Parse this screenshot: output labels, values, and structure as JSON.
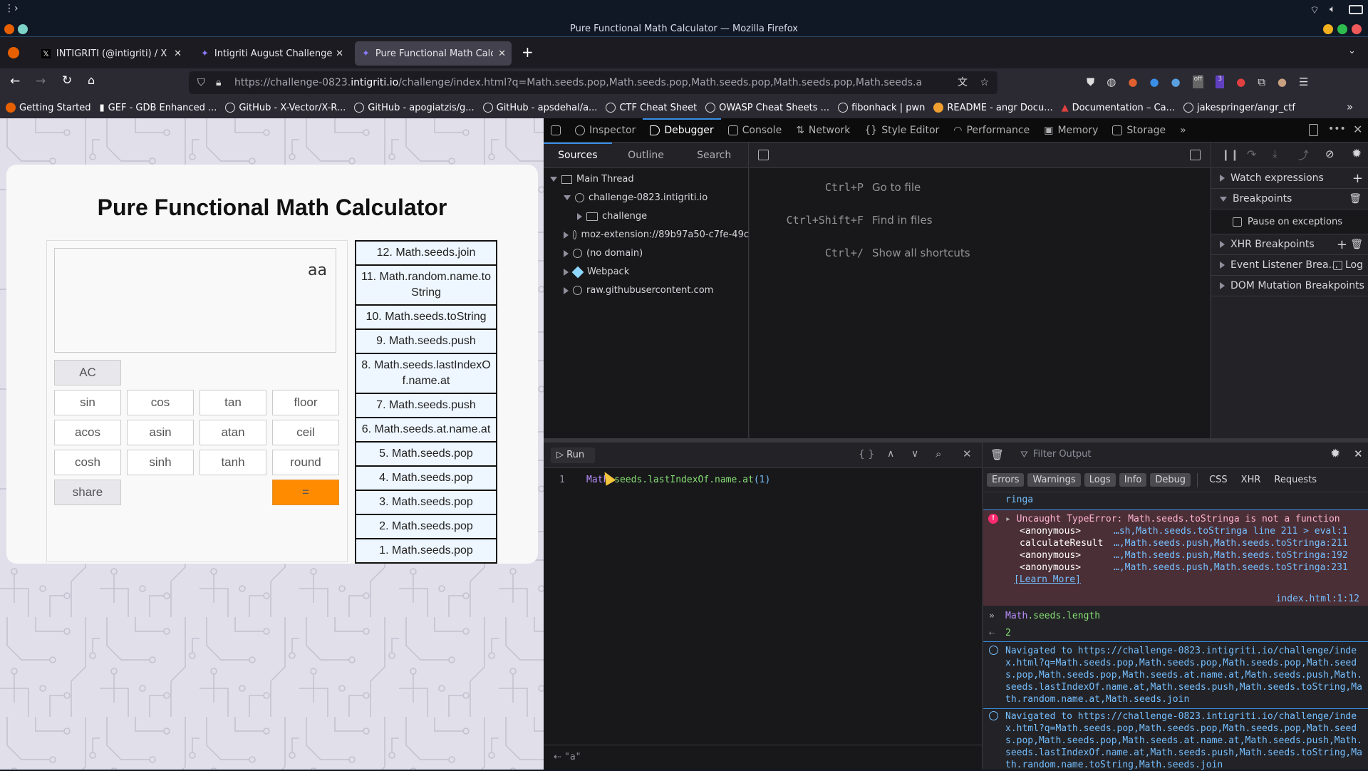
{
  "window": {
    "title": "Pure Functional Math Calculator — Mozilla Firefox"
  },
  "tabs": [
    {
      "label": "INTIGRITI (@intigriti) / X",
      "icon": "x-logo-icon"
    },
    {
      "label": "Intigriti August Challenge",
      "icon": "intigriti-icon"
    },
    {
      "label": "Pure Functional Math Calc",
      "icon": "intigriti-icon",
      "active": true
    }
  ],
  "url": {
    "prefix": "https://challenge-0823.",
    "domain": "intigriti.io",
    "path": "/challenge/index.html?q=Math.seeds.pop,Math.seeds.pop,Math.seeds.pop,Math.seeds.pop,Math.seeds.a"
  },
  "toolbar_badges": {
    "off": "off",
    "count": "3"
  },
  "bookmarks": [
    "Getting Started",
    "GEF - GDB Enhanced ...",
    "GitHub - X-Vector/X-R...",
    "GitHub - apogiatzis/g...",
    "GitHub - apsdehal/a...",
    "CTF Cheat Sheet",
    "OWASP Cheat Sheets ...",
    "fibonhack | pwn",
    "README - angr Docu...",
    "Documentation – Ca...",
    "jakespringer/angr_ctf"
  ],
  "calculator": {
    "title": "Pure Functional Math Calculator",
    "display": "aa",
    "buttons": {
      "ac": "AC",
      "row1": [
        "sin",
        "cos",
        "tan",
        "floor"
      ],
      "row2": [
        "acos",
        "asin",
        "atan",
        "ceil"
      ],
      "row3": [
        "cosh",
        "sinh",
        "tanh",
        "round"
      ],
      "share": "share",
      "equals": "="
    },
    "steps": [
      "12. Math.seeds.join",
      "11. Math.random.name.toString",
      "10. Math.seeds.toString",
      "9. Math.seeds.push",
      "8. Math.seeds.lastIndexOf.name.at",
      "7. Math.seeds.push",
      "6. Math.seeds.at.name.at",
      "5. Math.seeds.pop",
      "4. Math.seeds.pop",
      "3. Math.seeds.pop",
      "2. Math.seeds.pop",
      "1. Math.seeds.pop"
    ]
  },
  "devtools": {
    "tabs": [
      "Inspector",
      "Debugger",
      "Console",
      "Network",
      "Style Editor",
      "Performance",
      "Memory",
      "Storage"
    ],
    "active_tab": "Debugger",
    "sources_tabs": [
      "Sources",
      "Outline",
      "Search"
    ],
    "tree": {
      "main_thread": "Main Thread",
      "host": "challenge-0823.intigriti.io",
      "folder": "challenge",
      "items": [
        "moz-extension://89b97a50-c7fe-49c",
        "(no domain)",
        "Webpack",
        "raw.githubusercontent.com"
      ]
    },
    "shortcuts": [
      {
        "key": "Ctrl+P",
        "label": "Go to file"
      },
      {
        "key": "Ctrl+Shift+F",
        "label": "Find in files"
      },
      {
        "key": "Ctrl+/",
        "label": "Show all shortcuts"
      }
    ],
    "right_panel": {
      "watch": "Watch expressions",
      "breakpoints": "Breakpoints",
      "pause_exceptions": "Pause on exceptions",
      "xhr": "XHR Breakpoints",
      "event_listener": "Event Listener Brea...",
      "log": "Log",
      "dom_mutation": "DOM Mutation Breakpoints"
    },
    "editor": {
      "run_label": "Run",
      "line_number": "1",
      "code_obj": "Math",
      "code_rest": ".seeds.lastIndexOf.name.at",
      "code_args": "(1)",
      "result": "\"a\""
    },
    "console": {
      "filter_placeholder": "Filter Output",
      "filters": [
        "Errors",
        "Warnings",
        "Logs",
        "Info",
        "Debug"
      ],
      "filters_plain": [
        "CSS",
        "XHR",
        "Requests"
      ],
      "prev_fragment": "ringa",
      "error": {
        "message": "Uncaught TypeError: Math.seeds.toStringa is not a function",
        "stack": [
          {
            "fn": "<anonymous>",
            "loc": "…sh,Math.seeds.toStringa line 211 > eval:1"
          },
          {
            "fn": "calculateResult",
            "loc": "…,Math.seeds.push,Math.seeds.toStringa:211"
          },
          {
            "fn": "<anonymous>",
            "loc": "…,Math.seeds.push,Math.seeds.toStringa:192"
          },
          {
            "fn": "<anonymous>",
            "loc": "…,Math.seeds.push,Math.seeds.toStringa:231"
          }
        ],
        "learn_more": "[Learn More]",
        "source": "index.html:1:12"
      },
      "input_obj": "Math",
      "input_rest": ".seeds.length",
      "output": "2",
      "nav1": "Navigated to https://challenge-0823.intigriti.io/challenge/index.html?q=Math.seeds.pop,Math.seeds.pop,Math.seeds.pop,Math.seeds.pop,Math.seeds.pop,Math.seeds.at.name.at,Math.seeds.push,Math.seeds.lastIndexOf.name.at,Math.seeds.push,Math.seeds.toString,Math.random.name.at,Math.seeds.join",
      "nav2": "Navigated to https://challenge-0823.intigriti.io/challenge/index.html?q=Math.seeds.pop,Math.seeds.pop,Math.seeds.pop,Math.seeds.pop,Math.seeds.pop,Math.seeds.at.name.at,Math.seeds.push,Math.seeds.lastIndexOf.name.at,Math.seeds.push,Math.seeds.toString,Math.random.name.toString,Math.seeds.join"
    }
  }
}
